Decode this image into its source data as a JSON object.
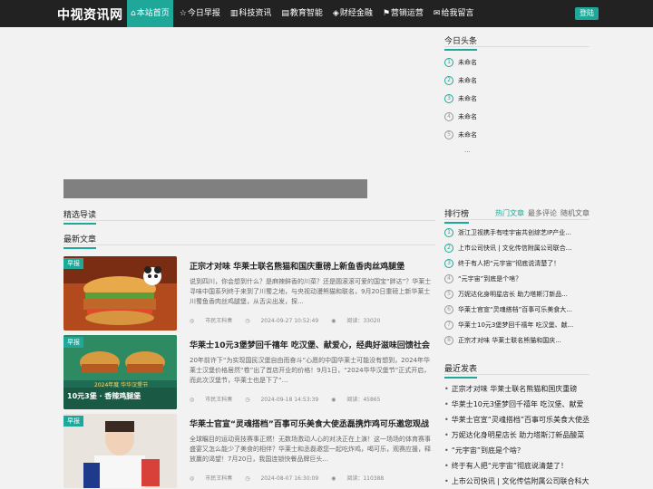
{
  "header": {
    "logo": "中视资讯网",
    "nav": [
      {
        "icon": "⌂",
        "label": "本站首页",
        "active": true
      },
      {
        "icon": "☆",
        "label": "今日早报"
      },
      {
        "icon": "▥",
        "label": "科技资讯"
      },
      {
        "icon": "▤",
        "label": "教育智能"
      },
      {
        "icon": "◈",
        "label": "财经金融"
      },
      {
        "icon": "⚑",
        "label": "营销运营"
      },
      {
        "icon": "✉",
        "label": "给我留言"
      }
    ],
    "login": "登陆"
  },
  "main": {
    "featured_heading": "精选导读",
    "latest_heading": "最新文章",
    "articles": [
      {
        "tag": "早报",
        "title": "正宗才对味 华莱士联名熊猫和国庆重磅上新鱼香肉丝鸡腿堡",
        "desc": "说到四川，你会想到什么？是麻辣鲜香的川菜？还是圆滚滚可爱的国宝“胖达”？华莱士寻味中国系列终于来到了川蜀之地，与央视动漫熊猫和联名，9月20日重磅上新华莱士川蜀鱼香肉丝鸡腿堡，从舌尖出发，探...",
        "author": "市民王科奏",
        "date": "2024-09-27 10:52:49",
        "views": "阅读：33020"
      },
      {
        "tag": "早报",
        "title": "华莱士10元3堡梦回千禧年 吃汉堡、献爱心，经典好滋味回馈社会",
        "desc": "20年前许下“为实现国民汉堡自由而奋斗”心愿的中国华莱士可能没有想到，2024年华莱士汉堡价格居然“卷”出了首店开业的价格！9月1日，“2024华华汉堡节”正式开启，而此次汉堡节，华莱士也是下了“...",
        "author": "市民王科奏",
        "date": "2024-09-18 14:53:39",
        "views": "阅读：45865"
      },
      {
        "tag": "早报",
        "title": "华莱士官宣“灵魂搭档”百事可乐美食大使丞磊携炸鸡可乐邀您观战",
        "desc": "全球瞩目的运动竞技赛事正燃！无数场激动人心的对决正在上演！这一场场的体育赛事盛宴又怎么能少了美食的相伴？华莱士和丞磊邀您一起吃炸鸡，喝可乐，观赛应援，释放赢的渴望！7月20日，我国连锁快餐品牌巨头...",
        "author": "市民王科奏",
        "date": "2024-08-07 16:30:09",
        "views": "阅读：110388"
      }
    ],
    "thumb2_caption": "10元3堡 · 香辣鸡腿堡",
    "thumb2_badge": "2024年度 华华汉堡节"
  },
  "sidebar": {
    "today_heading": "今日头条",
    "today_items": [
      "未命名",
      "未命名",
      "未命名",
      "未命名",
      "未命名"
    ],
    "today_more": "...",
    "rank_heading": "排行榜",
    "rank_tabs": [
      "热门文章",
      "最多评论",
      "随机文章"
    ],
    "rank_items": [
      "浙江卫视携手有哇宇宙共创综艺IP产业...",
      "上市公司快讯 | 文化传信附属公司联合...",
      "终于有人把“元宇宙”彻底说清楚了！",
      "“元宇宙”到底是个啥？",
      "万妮达化身明星店长 助力塔斯汀新品...",
      "华莱士官宣“灵魂搭档”百事可乐美食大...",
      "华莱士10元3堡梦回千禧年 吃汉堡、献...",
      "正宗才对味 华莱士联名熊猫和国庆..."
    ],
    "recent_heading": "最近发表",
    "recent_items": [
      "正宗才对味 华莱士联名熊猫和国庆重磅",
      "华莱士10元3堡梦回千禧年 吃汉堡、献爱",
      "华莱士官宣“灵魂搭档”百事可乐美食大使丞",
      "万妮达化身明星店长 助力塔斯汀新品酸菜",
      "“元宇宙”到底是个啥？",
      "终于有人把“元宇宙”彻底说清楚了！",
      "上市公司快讯 | 文化传信附属公司联合科大"
    ]
  },
  "colors": {
    "accent": "#1fa89a",
    "topbar": "#222222",
    "banner": "#808080"
  }
}
